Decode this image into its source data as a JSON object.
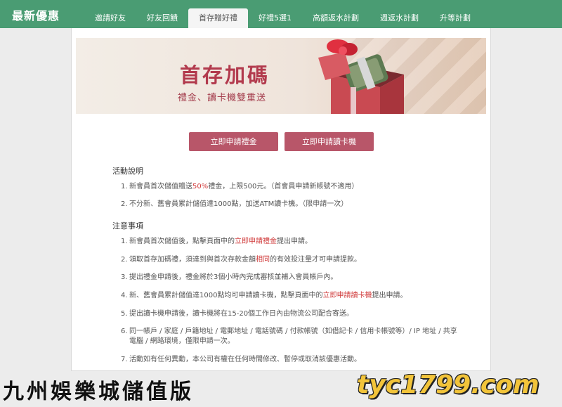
{
  "header": {
    "title": "最新優惠",
    "tabs": [
      "邀請好友",
      "好友回饋",
      "首存贈好禮",
      "好禮5選1",
      "高額返水計劃",
      "週返水計劃",
      "升等計劃"
    ],
    "active_tab": 2
  },
  "banner": {
    "title": "首存加碼",
    "subtitle": "禮金、讀卡機雙重送"
  },
  "buttons": {
    "apply_bonus": "立即申請禮金",
    "apply_card_reader": "立即申請讀卡機"
  },
  "activity": {
    "heading": "活動說明",
    "items": [
      {
        "num": "1.",
        "pre": "新會員首次儲值贈送",
        "red": "50%",
        "post": "禮金，上限500元。（首會員申請新帳號不適用）"
      },
      {
        "num": "2.",
        "pre": "不分新、舊會員累計儲值達1000點，加送ATM讀卡機。（限申請一次）",
        "red": "",
        "post": ""
      }
    ]
  },
  "notes": {
    "heading": "注意事項",
    "items": [
      {
        "num": "1.",
        "pre": "新會員首次儲值後，點擊頁面中的",
        "red": "立即申請禮金",
        "post": "提出申請。"
      },
      {
        "num": "2.",
        "pre": "領取首存加碼禮，須達到與首次存款金額",
        "red": "相同",
        "post": "的有效投注量才可申請提款。"
      },
      {
        "num": "3.",
        "pre": "提出禮金申請後，禮金將於3個小時內完成審核並補入會員帳戶內。",
        "red": "",
        "post": ""
      },
      {
        "num": "4.",
        "pre": "新、舊會員累計儲值達1000點均可申請讀卡機，點擊頁面中的",
        "red": "立即申請讀卡機",
        "post": "提出申請。"
      },
      {
        "num": "5.",
        "pre": "提出讀卡機申請後，讀卡機將在15-20個工作日內由物流公司配合寄送。",
        "red": "",
        "post": ""
      },
      {
        "num": "6.",
        "pre": "同一帳戶 / 家庭 / 戶籍地址 / 電郵地址 / 電話號碼 / 付款帳號（如借記卡 / 信用卡帳號等）/ IP 地址 / 共享電腦 / 網路環境，僅限申請一次。",
        "red": "",
        "post": ""
      },
      {
        "num": "7.",
        "pre": "活動如有任何異動，本公司有權在任何時間修改、暫停或取消該優惠活動。",
        "red": "",
        "post": ""
      }
    ]
  },
  "footer": {
    "left": "九州娛樂城儲值版",
    "right": "tyc1799.com"
  }
}
